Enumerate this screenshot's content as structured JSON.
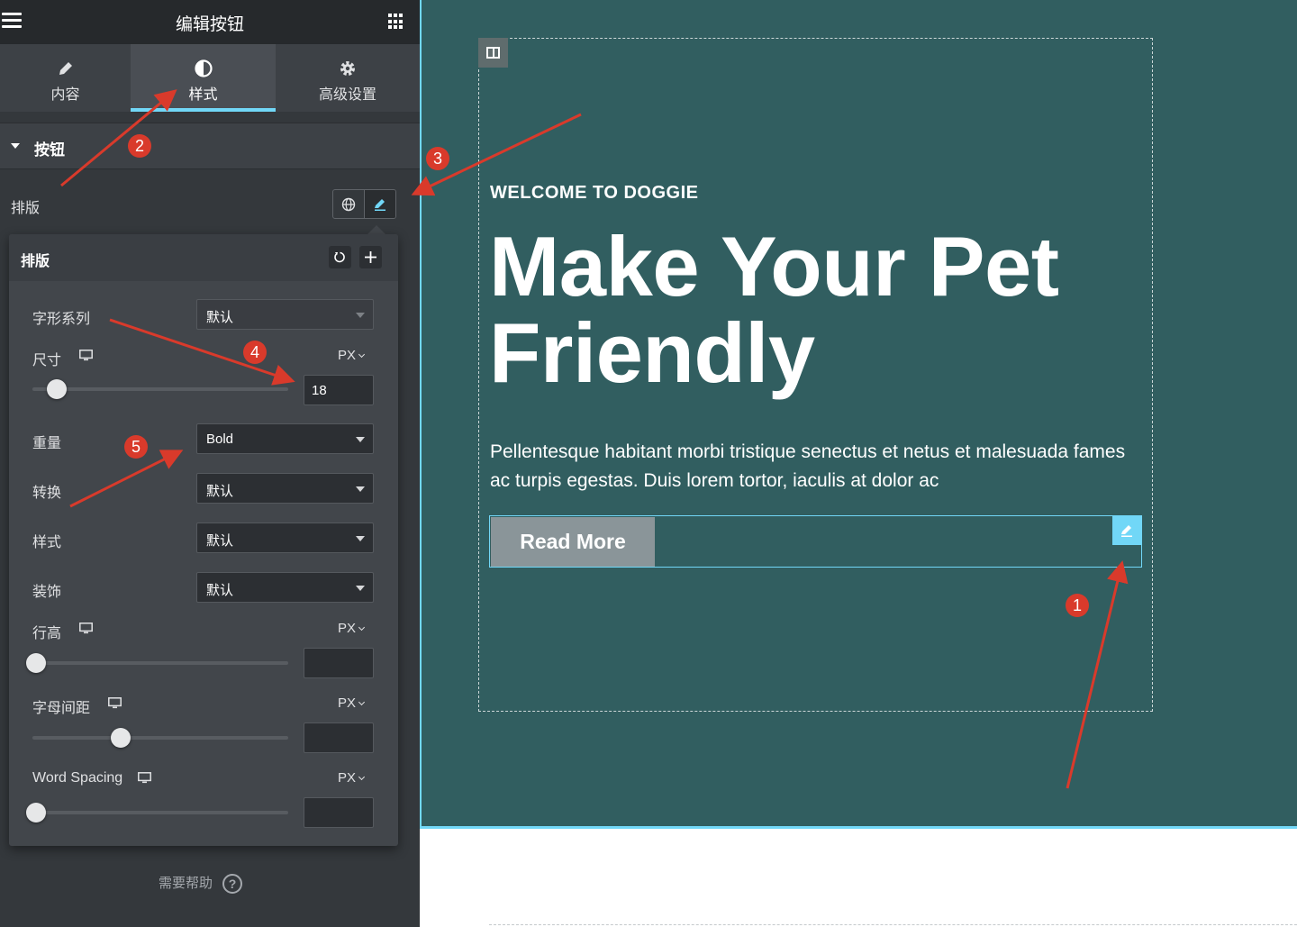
{
  "panel": {
    "title": "编辑按钮",
    "tabs": [
      {
        "label": "内容",
        "icon": "pencil-icon"
      },
      {
        "label": "样式",
        "icon": "half-circle-icon",
        "active": true
      },
      {
        "label": "高级设置",
        "icon": "gear-icon"
      }
    ],
    "section_title": "按钮",
    "typography_label": "排版",
    "help_label": "需要帮助",
    "accent_color": "#71d7f7"
  },
  "popover": {
    "title": "排版",
    "font_family": {
      "label": "字形系列",
      "value": "默认"
    },
    "size": {
      "label": "尺寸",
      "unit": "PX",
      "value": "18",
      "slider_fraction": 0.08
    },
    "weight": {
      "label": "重量",
      "value": "Bold"
    },
    "transform": {
      "label": "转换",
      "value": "默认"
    },
    "style": {
      "label": "样式",
      "value": "默认"
    },
    "decoration": {
      "label": "装饰",
      "value": "默认"
    },
    "line_height": {
      "label": "行高",
      "unit": "PX",
      "value": "",
      "slider_fraction": 0.0
    },
    "letter_spacing": {
      "label": "字母间距",
      "unit": "PX",
      "value": "",
      "slider_fraction": 0.33
    },
    "word_spacing": {
      "label": "Word Spacing",
      "unit": "PX",
      "value": "",
      "slider_fraction": 0.0
    }
  },
  "canvas": {
    "kicker": "WELCOME TO DOGGIE",
    "headline": "Make Your Pet Friendly",
    "body": "Pellentesque habitant morbi tristique senectus et netus et malesuada fames ac turpis egestas. Duis lorem tortor, iaculis at dolor ac",
    "button_label": "Read More",
    "background_color": "#315e60",
    "button_color": "#8a9599"
  },
  "annotations": [
    "1",
    "2",
    "3",
    "4",
    "5"
  ]
}
